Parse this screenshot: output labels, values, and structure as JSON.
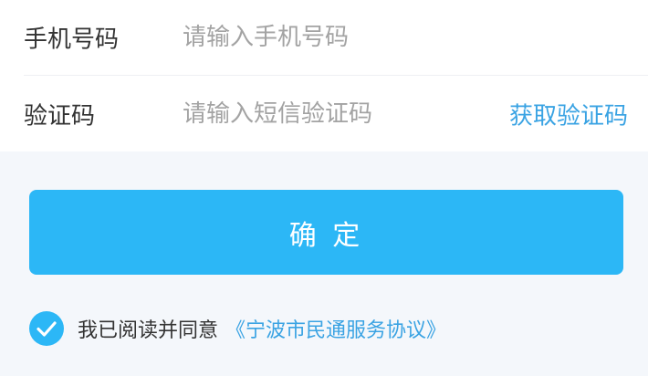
{
  "form": {
    "phone": {
      "label": "手机号码",
      "placeholder": "请输入手机号码",
      "value": ""
    },
    "code": {
      "label": "验证码",
      "placeholder": "请输入短信验证码",
      "value": "",
      "get_code_label": "获取验证码"
    }
  },
  "confirm": {
    "label": "确 定"
  },
  "agreement": {
    "checked": true,
    "check_icon": "check-circle-icon",
    "text": "我已阅读并同意",
    "link": "《宁波市民通服务协议》"
  },
  "colors": {
    "accent": "#2cb7f6",
    "link": "#3aa3e3",
    "text": "#333333",
    "placeholder": "#a3a3a3",
    "background": "#f4f7fb"
  }
}
